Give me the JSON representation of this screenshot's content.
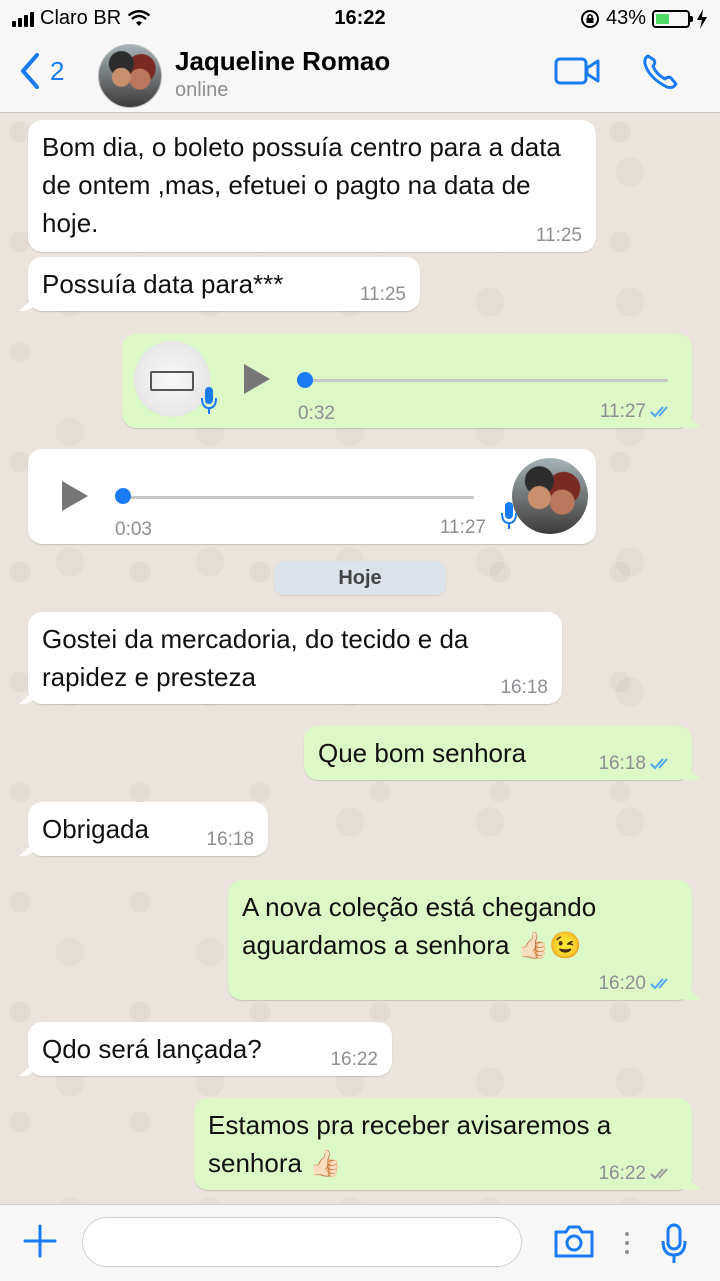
{
  "status_bar": {
    "carrier": "Claro BR",
    "time": "16:22",
    "battery": "43%",
    "battery_level": 0.43
  },
  "header": {
    "back_count": "2",
    "name": "Jaqueline Romao",
    "status": "online"
  },
  "messages": [
    {
      "direction": "in",
      "text": "Bom dia, o boleto possuía centro para a data de ontem ,mas, efetuei o pagto na data de hoje.",
      "time": "11:25"
    },
    {
      "direction": "in",
      "text": "Possuía data para***",
      "time": "11:25"
    },
    {
      "direction": "out",
      "type": "audio",
      "duration": "0:32",
      "time": "11:27",
      "read": true,
      "progress": 0
    },
    {
      "direction": "in",
      "type": "audio",
      "duration": "0:03",
      "time": "11:27",
      "progress": 0
    },
    {
      "direction": "in",
      "text": "Gostei da mercadoria, do tecido e da rapidez e presteza",
      "time": "16:18"
    },
    {
      "direction": "out",
      "text": "Que bom senhora",
      "time": "16:18",
      "read": true
    },
    {
      "direction": "in",
      "text": "Obrigada",
      "time": "16:18"
    },
    {
      "direction": "out",
      "text": "A nova coleção está chegando aguardamos a senhora",
      "emoji": "👍🏻😉",
      "time": "16:20",
      "read": true
    },
    {
      "direction": "in",
      "text": "Qdo será lançada?",
      "time": "16:22"
    },
    {
      "direction": "out",
      "text": "Estamos pra receber avisaremos a senhora",
      "emoji": "👍🏻",
      "time": "16:22",
      "read": false
    }
  ],
  "day_divider": "Hoje",
  "colors": {
    "accent": "#1a7cf5",
    "outgoing_bubble": "#dcf8c6",
    "incoming_bubble": "#ffffff",
    "read_ticks": "#4fa8f2",
    "delivered_ticks": "#9a9a9a"
  },
  "icons": [
    "signal-icon",
    "wifi-icon",
    "orientation-lock-icon",
    "battery-icon",
    "charging-icon",
    "back-chevron-icon",
    "video-call-icon",
    "phone-icon",
    "play-icon",
    "mic-icon",
    "plus-icon",
    "camera-icon",
    "more-dots-icon"
  ],
  "composer": {
    "placeholder": ""
  }
}
